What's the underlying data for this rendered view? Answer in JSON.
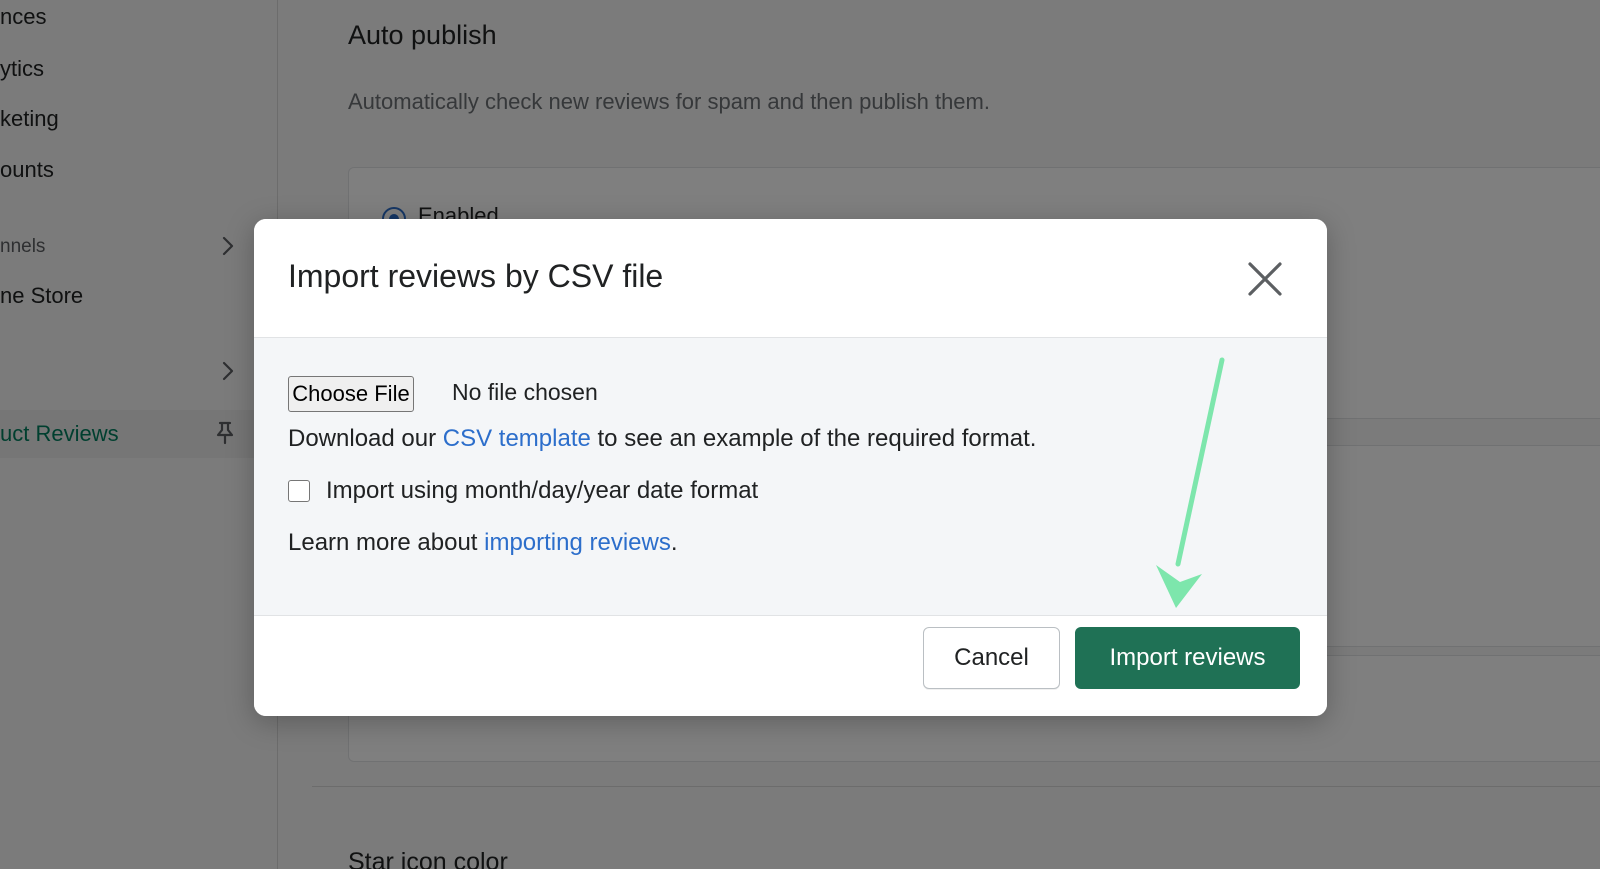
{
  "sidebar": {
    "items": [
      {
        "label": "nces"
      },
      {
        "label": "ytics"
      },
      {
        "label": "keting"
      },
      {
        "label": "ounts"
      }
    ],
    "section_label": "nnels",
    "online_store_label": "ne Store",
    "active_item_label": "uct Reviews",
    "active_color": "#007f5f"
  },
  "settings": {
    "auto_publish_title": "Auto publish",
    "auto_publish_description": "Automatically check new reviews for spam and then publish them.",
    "radio_enabled_label": "Enabled",
    "star_icon_color_title": "Star icon color"
  },
  "modal": {
    "title": "Import reviews by CSV file",
    "close_icon": "close-icon",
    "file_picker_button_label": "Choose File",
    "file_status": "No file chosen",
    "download_prefix": "Download our ",
    "csv_template_link": "CSV template",
    "download_suffix": " to see an example of the required format.",
    "date_format_checkbox_label": "Import using month/day/year date format",
    "date_format_checked": false,
    "learn_more_prefix": "Learn more about ",
    "importing_reviews_link": "importing reviews",
    "learn_more_suffix": ".",
    "cancel_label": "Cancel",
    "import_label": "Import reviews",
    "primary_color": "#1f7155",
    "link_color": "#2c6ecb"
  },
  "annotation": {
    "arrow_color": "#7de6ac",
    "arrow_icon": "arrow-down-icon"
  }
}
